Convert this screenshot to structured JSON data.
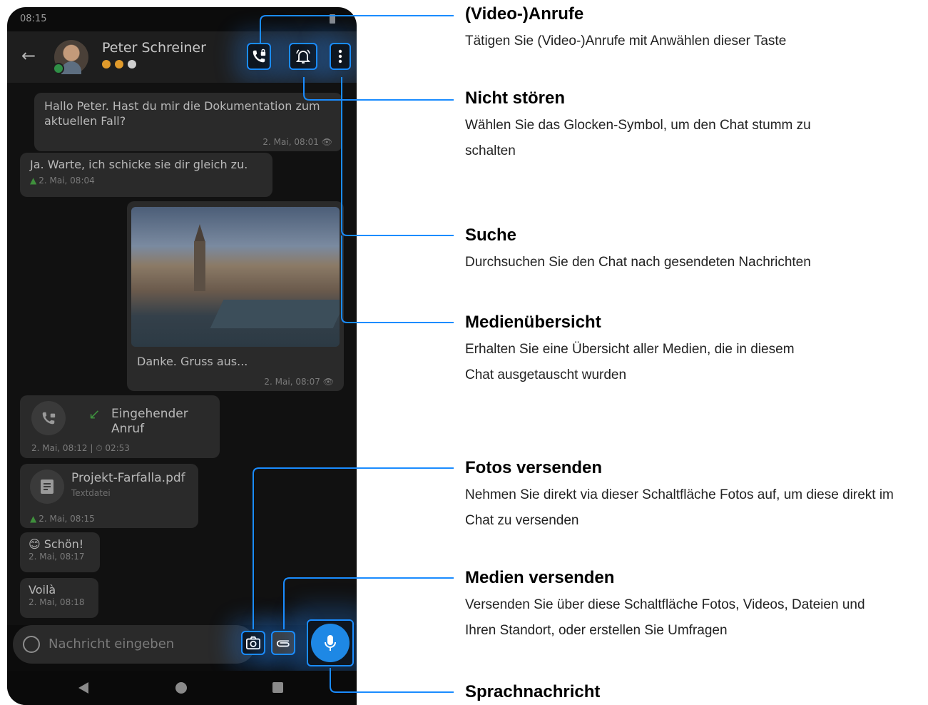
{
  "status": {
    "time": "08:15"
  },
  "header": {
    "back_icon": "arrow-left-icon",
    "contact_name": "Peter Schreiner",
    "trust_dots": [
      "#e09a2b",
      "#e09a2b",
      "#cfcfcf"
    ]
  },
  "messages": [
    {
      "text": "Hallo Peter. Hast du mir die Dokumentation zum aktuellen Fall?",
      "meta": "2. Mai, 08:01"
    },
    {
      "text": "Ja. Warte, ich schicke sie dir gleich zu.",
      "meta": "2. Mai, 08:04"
    },
    {
      "text": "Danke. Gruss aus...",
      "meta": "2. Mai, 08:07"
    },
    {
      "text": "Eingehender Anruf",
      "meta": "2. Mai, 08:12 | ⏱ 02:53"
    },
    {
      "text": "Projekt-Farfalla.pdf",
      "sub": "Textdatei",
      "meta": "2. Mai, 08:15"
    },
    {
      "text": "😊 Schön!",
      "meta": "2. Mai, 08:17"
    },
    {
      "text": "Voilà",
      "meta": "2. Mai, 08:18"
    }
  ],
  "composer": {
    "placeholder": "Nachricht eingeben"
  },
  "annotations": [
    {
      "title": "(Video-)Anrufe",
      "desc": "Tätigen Sie (Video-)Anrufe mit Anwählen dieser Taste"
    },
    {
      "title": "Nicht stören",
      "desc": "Wählen Sie das Glocken-Symbol, um den Chat stumm zu schalten"
    },
    {
      "title": "Suche",
      "desc": "Durchsuchen Sie den Chat nach gesendeten Nachrichten"
    },
    {
      "title": "Medienübersicht",
      "desc": "Erhalten Sie eine Übersicht aller Medien, die in diesem Chat ausgetauscht wurden"
    },
    {
      "title": "Fotos versenden",
      "desc": "Nehmen Sie direkt via dieser Schaltfläche Fotos auf, um diese direkt im Chat zu versenden"
    },
    {
      "title": "Medien versenden",
      "desc": "Versenden Sie über diese Schaltfläche Fotos, Videos, Dateien und Ihren Standort, oder erstellen Sie Umfragen"
    },
    {
      "title": "Sprachnachricht",
      "desc": ""
    }
  ],
  "colors": {
    "accent": "#1a8cff",
    "bubble": "#2a2a2a",
    "mic": "#1e88e5",
    "read_green": "#3f8f3c"
  }
}
